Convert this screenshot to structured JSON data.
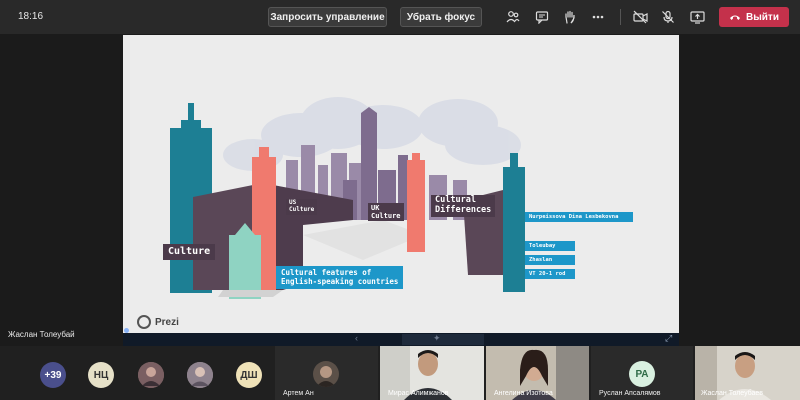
{
  "topbar": {
    "timer": "18:16",
    "request_control": "Запросить управление",
    "remove_focus": "Убрать фокус",
    "leave": "Выйти"
  },
  "stage": {
    "speaker_name": "Жаслан Толеубай"
  },
  "slide": {
    "labels": {
      "culture": "Culture",
      "us_culture": "US\nCulture",
      "uk_culture": "UK\nCulture",
      "cultural_differences": "Cultural\nDifferences",
      "cultural_features": "Cultural features of\nEnglish-speaking countries",
      "author": "Nurpeissova Dina Lesbekovna",
      "name1": "Toleubay",
      "name2": "Zhaslan",
      "group": "VT 20-1 rod"
    },
    "brand": "Prezi"
  },
  "participants": {
    "overflow_count": "+39",
    "avatars": [
      {
        "initials": "НЦ",
        "color": "#e6e1c8",
        "text_color": "#333333"
      },
      {
        "initials": "",
        "color": "#8a6b6b",
        "text_color": "#ffffff"
      },
      {
        "initials": "",
        "color": "#9b8f9a",
        "text_color": "#ffffff"
      },
      {
        "initials": "ДШ",
        "color": "#efe2b8",
        "text_color": "#333333"
      }
    ],
    "tiles": [
      {
        "name": "Артем Ан",
        "video": false
      },
      {
        "name": "Мирас Алимжанов",
        "video": true
      },
      {
        "name": "Ангелина Изотова",
        "video": true
      },
      {
        "name": "Руслан Апсалямов",
        "video": false,
        "initials": "РА"
      },
      {
        "name": "Жаслан Толеубаев",
        "video": true
      }
    ]
  },
  "colors": {
    "teal": "#1d7f94",
    "salmon": "#f07a6e",
    "mint": "#8fd3c2",
    "plum": "#5a4757",
    "leave": "#c4314b"
  }
}
